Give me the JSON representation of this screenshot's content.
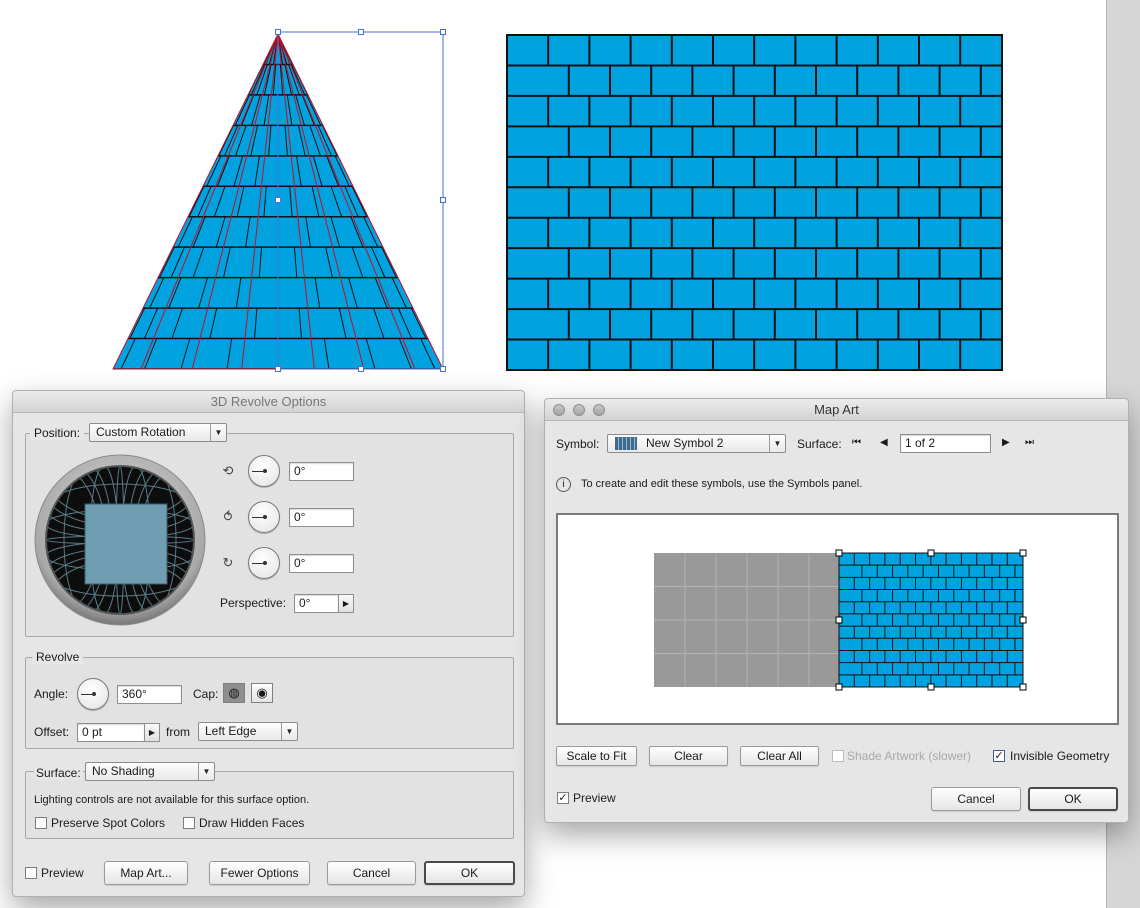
{
  "canvas": {
    "fill_color": "#00a3e0",
    "stroke_color": "#111111",
    "guide_color": "#c0102a",
    "selection_color": "#4a6fd8"
  },
  "revolve": {
    "title": "3D Revolve Options",
    "position": {
      "label": "Position:",
      "value": "Custom Rotation",
      "x_rotation": "0°",
      "y_rotation": "0°",
      "z_rotation": "0°",
      "perspective_label": "Perspective:",
      "perspective_value": "0°"
    },
    "revolve_group": {
      "label": "Revolve",
      "angle_label": "Angle:",
      "angle_value": "360°",
      "cap_label": "Cap:",
      "offset_label": "Offset:",
      "offset_value": "0 pt",
      "from_label": "from",
      "from_value": "Left Edge"
    },
    "surface": {
      "label": "Surface:",
      "value": "No Shading",
      "note": "Lighting controls are not available for this surface option.",
      "preserve_spot": "Preserve Spot Colors",
      "draw_hidden": "Draw Hidden Faces"
    },
    "buttons": {
      "preview": "Preview",
      "map_art": "Map Art...",
      "fewer_options": "Fewer Options",
      "cancel": "Cancel",
      "ok": "OK"
    }
  },
  "mapart": {
    "title": "Map Art",
    "symbol_label": "Symbol:",
    "symbol_value": "New Symbol 2",
    "surface_label": "Surface:",
    "surface_value": "1 of 2",
    "info": "To create and edit these symbols, use the Symbols panel.",
    "buttons": {
      "scale_to_fit": "Scale to Fit",
      "clear": "Clear",
      "clear_all": "Clear All",
      "shade_artwork": "Shade Artwork (slower)",
      "invisible_geometry": "Invisible Geometry",
      "preview": "Preview",
      "cancel": "Cancel",
      "ok": "OK"
    },
    "shade_artwork_checked": false,
    "invisible_geometry_checked": true,
    "preview_checked": true
  }
}
